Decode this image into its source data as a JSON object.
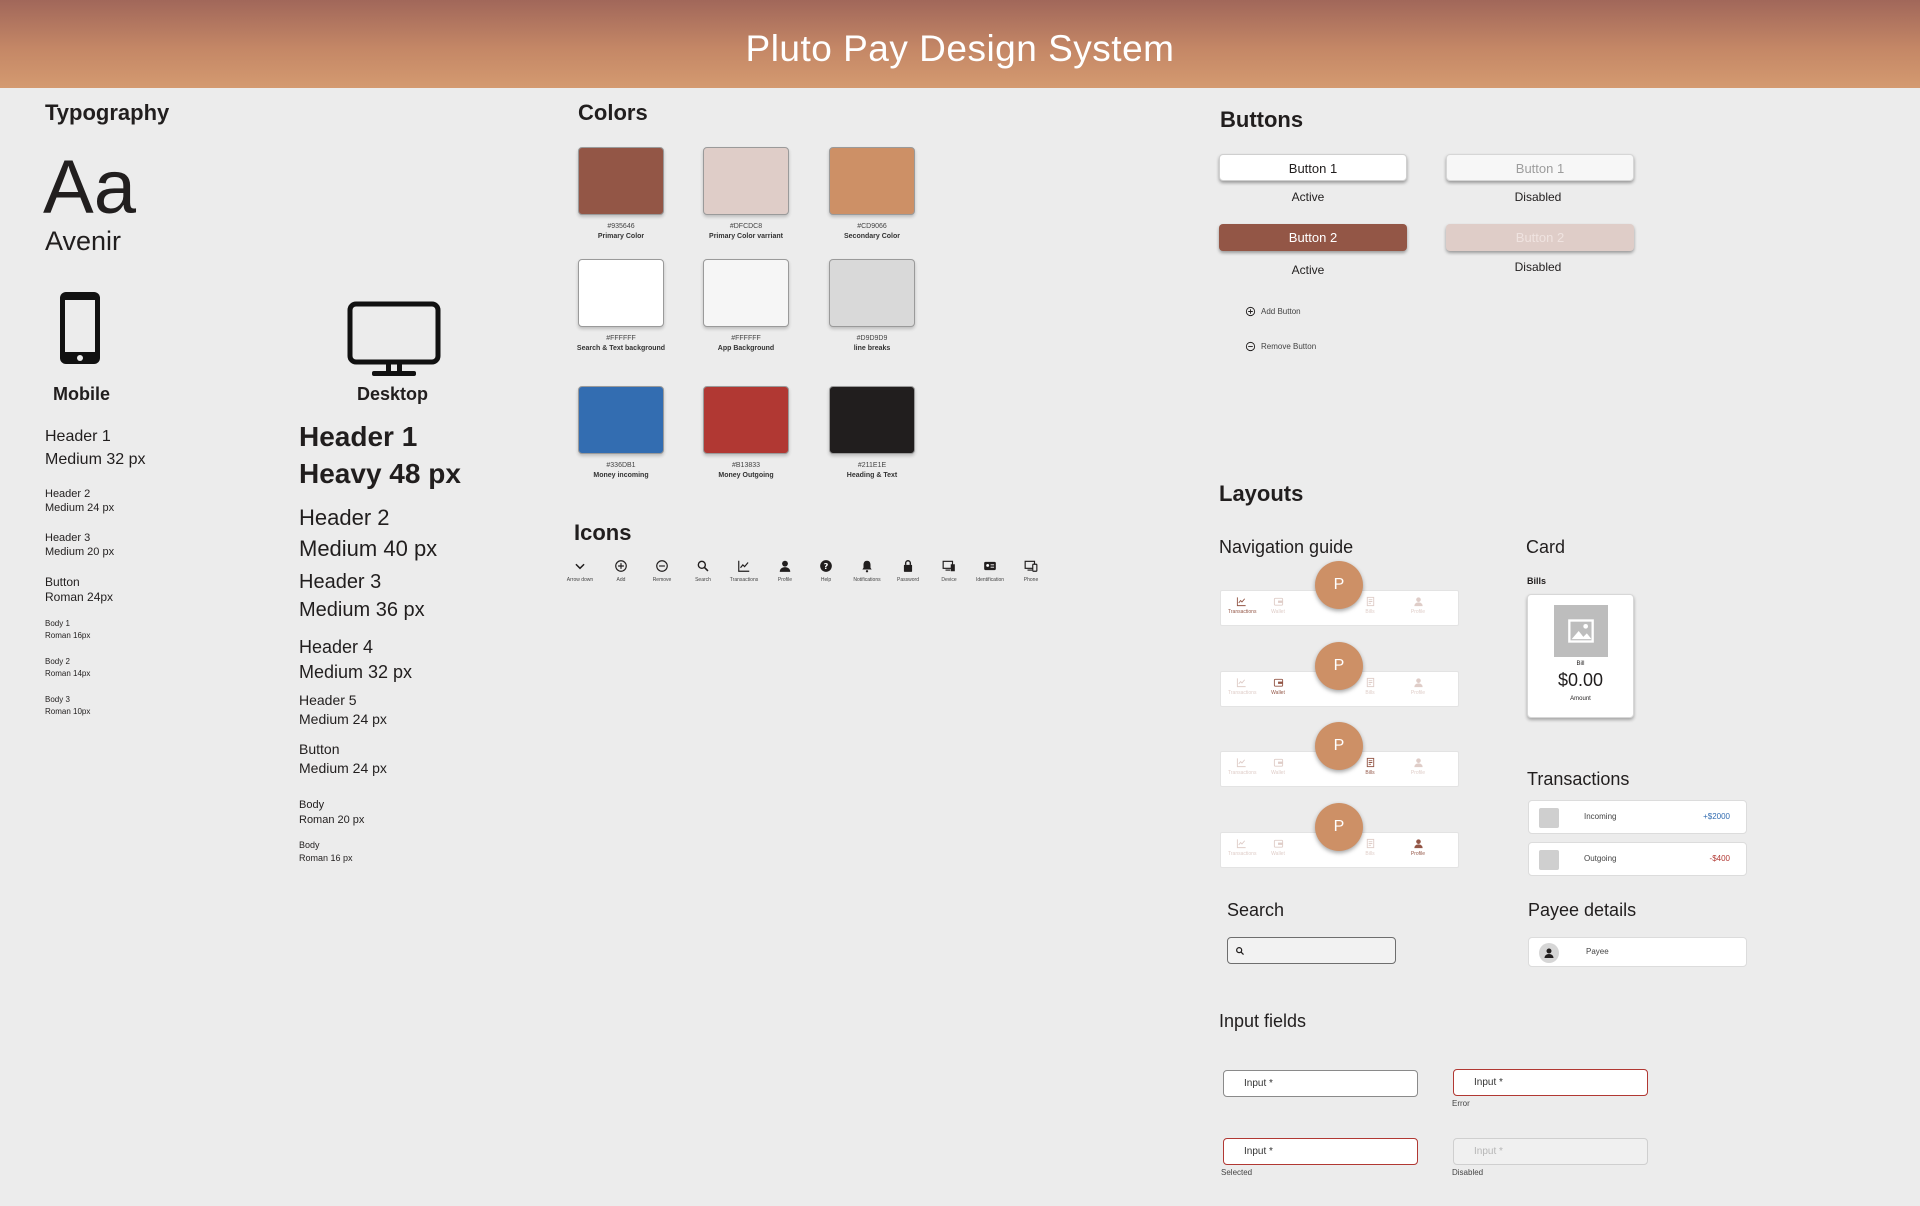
{
  "header": {
    "title": "Pluto Pay Design System"
  },
  "typography": {
    "title": "Typography",
    "sample": "Aa",
    "font_name": "Avenir",
    "mobile": {
      "label": "Mobile",
      "specs": [
        {
          "name": "Header 1",
          "detail": "Medium  32 px"
        },
        {
          "name": "Header 2",
          "detail": "Medium  24 px"
        },
        {
          "name": "Header 3",
          "detail": "Medium  20 px"
        },
        {
          "name": "Button",
          "detail": "Roman  24px"
        },
        {
          "name": "Body 1",
          "detail": "Roman  16px"
        },
        {
          "name": "Body 2",
          "detail": "Roman  14px"
        },
        {
          "name": "Body 3",
          "detail": "Roman  10px"
        }
      ]
    },
    "desktop": {
      "label": "Desktop",
      "specs": [
        {
          "name": "Header 1",
          "detail": "Heavy  48 px"
        },
        {
          "name": "Header 2",
          "detail": "Medium  40 px"
        },
        {
          "name": "Header 3",
          "detail": "Medium  36 px"
        },
        {
          "name": "Header 4",
          "detail": "Medium  32 px"
        },
        {
          "name": "Header 5",
          "detail": "Medium  24 px"
        },
        {
          "name": "Button",
          "detail": "Medium  24 px"
        },
        {
          "name": "Body",
          "detail": "Roman  20 px"
        },
        {
          "name": "Body",
          "detail": "Roman  16 px"
        }
      ]
    }
  },
  "colors": {
    "title": "Colors",
    "swatches": [
      {
        "hex": "#935646",
        "name": "Primary Color",
        "color": "#935646"
      },
      {
        "hex": "#DFCDC8",
        "name": "Primary Color varriant",
        "color": "#DFCDC8"
      },
      {
        "hex": "#CD9066",
        "name": "Secondary Color",
        "color": "#CD9066"
      },
      {
        "hex": "#FFFFFF",
        "name": "Search & Text background",
        "color": "#FFFFFF"
      },
      {
        "hex": "#FFFFFF",
        "name": "App Background",
        "color": "#F6F6F6"
      },
      {
        "hex": "#D9D9D9",
        "name": "line breaks",
        "color": "#D9D9D9"
      },
      {
        "hex": "#336DB1",
        "name": "Money incoming",
        "color": "#336DB1"
      },
      {
        "hex": "#B13833",
        "name": "Money Outgoing",
        "color": "#B13833"
      },
      {
        "hex": "#211E1E",
        "name": "Heading & Text",
        "color": "#211E1E"
      }
    ]
  },
  "icons": {
    "title": "Icons",
    "items": [
      {
        "name": "chevron-down-icon",
        "label": "Arrow down"
      },
      {
        "name": "add-icon",
        "label": "Add"
      },
      {
        "name": "remove-icon",
        "label": "Remove"
      },
      {
        "name": "search-icon",
        "label": "Search"
      },
      {
        "name": "transactions-icon",
        "label": "Transactions"
      },
      {
        "name": "profile-icon",
        "label": "Profile"
      },
      {
        "name": "help-icon",
        "label": "Help"
      },
      {
        "name": "notifications-icon",
        "label": "Notifications"
      },
      {
        "name": "password-icon",
        "label": "Password"
      },
      {
        "name": "device-icon",
        "label": "Device"
      },
      {
        "name": "identification-icon",
        "label": "Identification"
      },
      {
        "name": "phone-icon",
        "label": "Phone"
      }
    ]
  },
  "buttons": {
    "title": "Buttons",
    "button1": "Button 1",
    "button2": "Button 2",
    "active": "Active",
    "disabled": "Disabled",
    "add": "Add Button",
    "remove": "Remove Button"
  },
  "layouts": {
    "title": "Layouts",
    "nav_title": "Navigation guide",
    "nav_labels": [
      "Transactions",
      "Wallet",
      "Bills",
      "Profile"
    ],
    "fab_letter": "P",
    "active_indices": [
      0,
      1,
      2,
      3
    ],
    "card_title": "Card",
    "card_section": "Bills",
    "card_label": "Bill",
    "card_amount": "$0.00",
    "card_amount_label": "Amount",
    "transactions_title": "Transactions",
    "transactions": [
      {
        "label": "Incoming",
        "amount": "+$2000",
        "color": "#336DB1"
      },
      {
        "label": "Outgoing",
        "amount": "-$400",
        "color": "#B13833"
      }
    ],
    "search_title": "Search",
    "payee_title": "Payee details",
    "payee_label": "Payee"
  },
  "inputs": {
    "title": "Input fields",
    "placeholder": "Input *",
    "error": "Error",
    "selected": "Selected",
    "disabled": "Disabled"
  }
}
